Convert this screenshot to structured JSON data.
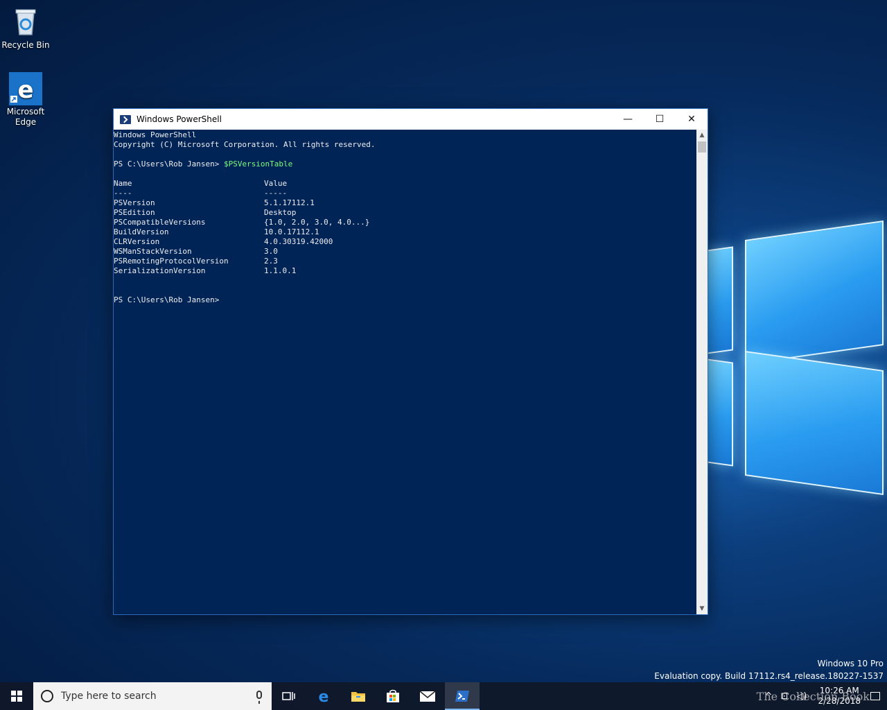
{
  "desktop": {
    "icons": [
      {
        "label": "Recycle Bin",
        "icon": "recycle-bin-icon"
      },
      {
        "label": "Microsoft\nEdge",
        "label_line1": "Microsoft",
        "label_line2": "Edge",
        "icon": "edge-icon"
      }
    ]
  },
  "window": {
    "title": "Windows PowerShell",
    "controls": {
      "minimize": "—",
      "maximize": "☐",
      "close": "✕"
    }
  },
  "console": {
    "header_lines": [
      "Windows PowerShell",
      "Copyright (C) Microsoft Corporation. All rights reserved."
    ],
    "prompt": "PS C:\\Users\\Rob Jansen> ",
    "command": "$PSVersionTable",
    "table_headers": [
      "Name",
      "Value"
    ],
    "table_separators": [
      "----",
      "-----"
    ],
    "rows": [
      {
        "name": "PSVersion",
        "value": "5.1.17112.1"
      },
      {
        "name": "PSEdition",
        "value": "Desktop"
      },
      {
        "name": "PSCompatibleVersions",
        "value": "{1.0, 2.0, 3.0, 4.0...}"
      },
      {
        "name": "BuildVersion",
        "value": "10.0.17112.1"
      },
      {
        "name": "CLRVersion",
        "value": "4.0.30319.42000"
      },
      {
        "name": "WSManStackVersion",
        "value": "3.0"
      },
      {
        "name": "PSRemotingProtocolVersion",
        "value": "2.3"
      },
      {
        "name": "SerializationVersion",
        "value": "1.1.0.1"
      }
    ],
    "final_prompt": "PS C:\\Users\\Rob Jansen>"
  },
  "watermark": {
    "edition": "Windows 10 Pro",
    "build": "Evaluation copy. Build 17112.rs4_release.180227-1537"
  },
  "taskbar": {
    "search_placeholder": "Type here to search",
    "apps": [
      "task-view-icon",
      "edge-icon",
      "file-explorer-icon",
      "store-icon",
      "mail-icon",
      "powershell-icon"
    ],
    "clock_time": "10:26 AM",
    "clock_date": "2/28/2018",
    "overlay_text": "The Collection Book"
  },
  "colors": {
    "console_bg": "#012456",
    "console_fg": "#eeedf0",
    "command_color": "#7cfc7c",
    "accent": "#2a6bbf"
  }
}
